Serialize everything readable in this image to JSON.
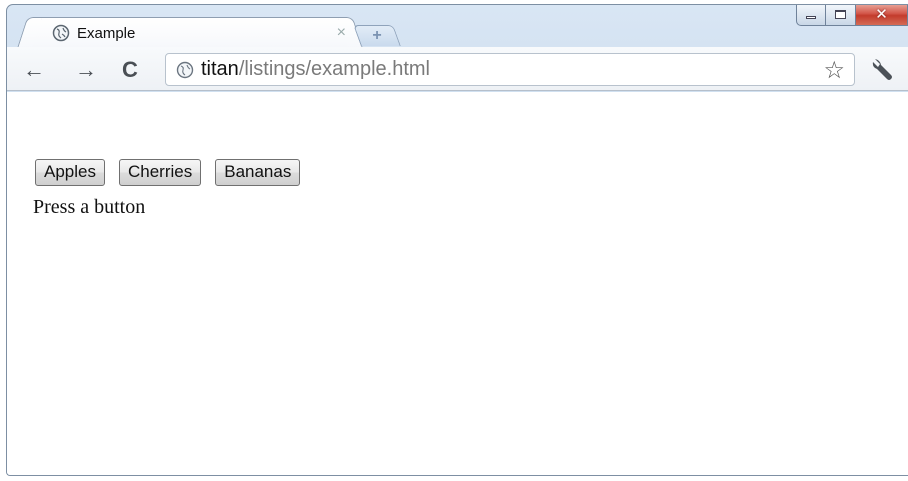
{
  "window": {
    "caption_buttons": [
      "minimize",
      "maximize",
      "close"
    ],
    "close_color": "#c33b2c"
  },
  "tab": {
    "title": "Example",
    "close_glyph": "×",
    "icon": "globe-icon"
  },
  "new_tab": {
    "glyph": "+"
  },
  "toolbar": {
    "back_glyph": "←",
    "forward_glyph": "→",
    "reload_glyph": "C",
    "url_host": "titan",
    "url_path": "/listings/example.html",
    "star_glyph": "☆",
    "wrench_icon": "wrench-icon"
  },
  "page": {
    "buttons": [
      "Apples",
      "Cherries",
      "Bananas"
    ],
    "status_text": "Press a button"
  }
}
